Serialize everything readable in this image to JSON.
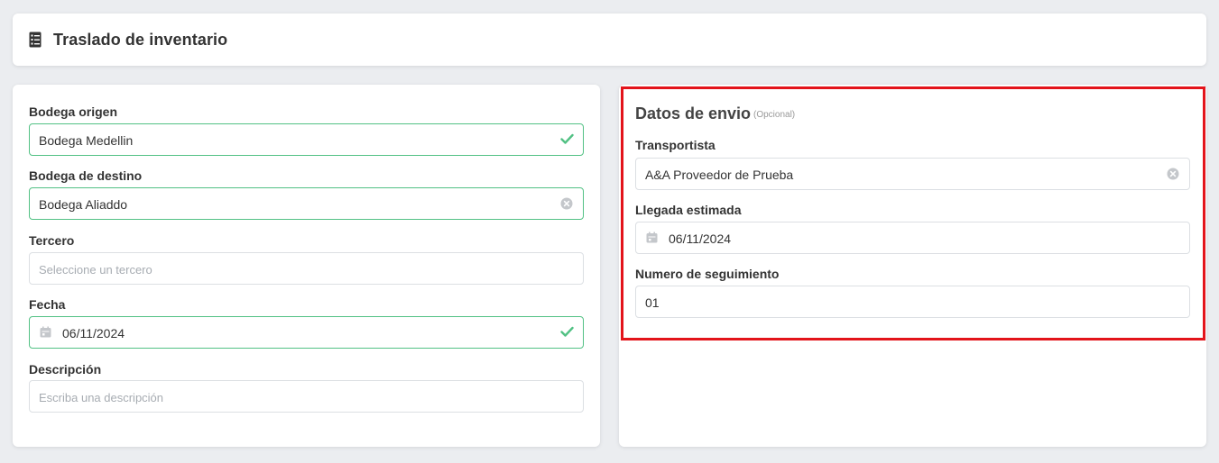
{
  "header": {
    "title": "Traslado de inventario",
    "icon": "checklist-icon"
  },
  "form": {
    "origin": {
      "label": "Bodega origen",
      "value": "Bodega Medellin",
      "status": "valid"
    },
    "destination": {
      "label": "Bodega de destino",
      "value": "Bodega Aliaddo",
      "status": "valid"
    },
    "third_party": {
      "label": "Tercero",
      "placeholder": "Seleccione un tercero"
    },
    "date": {
      "label": "Fecha",
      "value": "06/11/2024",
      "status": "valid"
    },
    "description": {
      "label": "Descripción",
      "placeholder": "Escriba una descripción"
    }
  },
  "shipping": {
    "title": "Datos de envio",
    "note": "(Opcional)",
    "carrier": {
      "label": "Transportista",
      "value": "A&A Proveedor de Prueba"
    },
    "eta": {
      "label": "Llegada estimada",
      "value": "06/11/2024"
    },
    "tracking": {
      "label": "Numero de seguimiento",
      "value": "01"
    }
  },
  "colors": {
    "valid": "#52c184",
    "highlight": "#e3141b",
    "background": "#ebedf0"
  }
}
